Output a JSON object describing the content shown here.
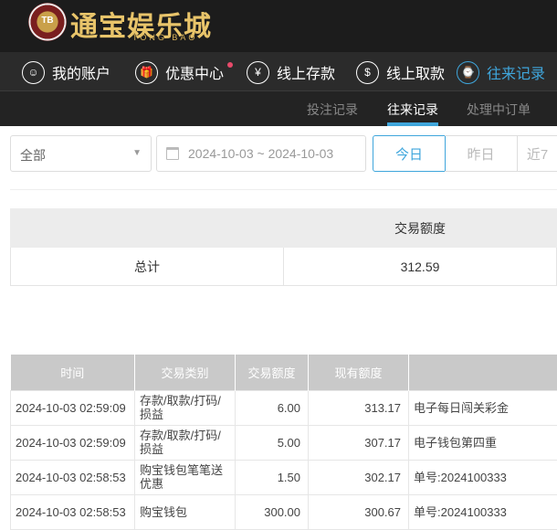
{
  "brand": {
    "chip": "TB",
    "name": "通宝娱乐城",
    "sub": "TONG BAO"
  },
  "nav": [
    {
      "label": "我的账户",
      "icon": "user-icon",
      "glyph": "☺"
    },
    {
      "label": "优惠中心",
      "icon": "gift-icon",
      "glyph": "🎁",
      "badge": true
    },
    {
      "label": "线上存款",
      "icon": "deposit-icon",
      "glyph": "¥"
    },
    {
      "label": "线上取款",
      "icon": "withdraw-icon",
      "glyph": "$"
    },
    {
      "label": "往来记录",
      "icon": "record-icon",
      "glyph": "⌚",
      "active": true
    }
  ],
  "subtabs": [
    {
      "label": "投注记录"
    },
    {
      "label": "往来记录",
      "active": true
    },
    {
      "label": "处理中订单"
    }
  ],
  "filter": {
    "type": "全部",
    "date_range": "2024-10-03 ~ 2024-10-03",
    "quick": [
      "今日",
      "昨日",
      "近7"
    ]
  },
  "summary": {
    "header": "交易额度",
    "label": "总计",
    "value": "312.59"
  },
  "table": {
    "columns": [
      "时间",
      "交易类别",
      "交易额度",
      "现有额度",
      ""
    ],
    "rows": [
      [
        "2024-10-03 02:59:09",
        "存款/取款/打码/损益",
        "6.00",
        "313.17",
        "电子每日闯关彩金"
      ],
      [
        "2024-10-03 02:59:09",
        "存款/取款/打码/损益",
        "5.00",
        "307.17",
        "电子钱包第四重"
      ],
      [
        "2024-10-03 02:58:53",
        "购宝钱包笔笔送优惠",
        "1.50",
        "302.17",
        "单号:2024100333"
      ],
      [
        "2024-10-03 02:58:53",
        "购宝钱包",
        "300.00",
        "300.67",
        "单号:2024100333"
      ]
    ]
  },
  "colors": {
    "accent": "#3fa6dc",
    "header_bg": "#1c1c1c",
    "badge": "#e84a6a"
  }
}
